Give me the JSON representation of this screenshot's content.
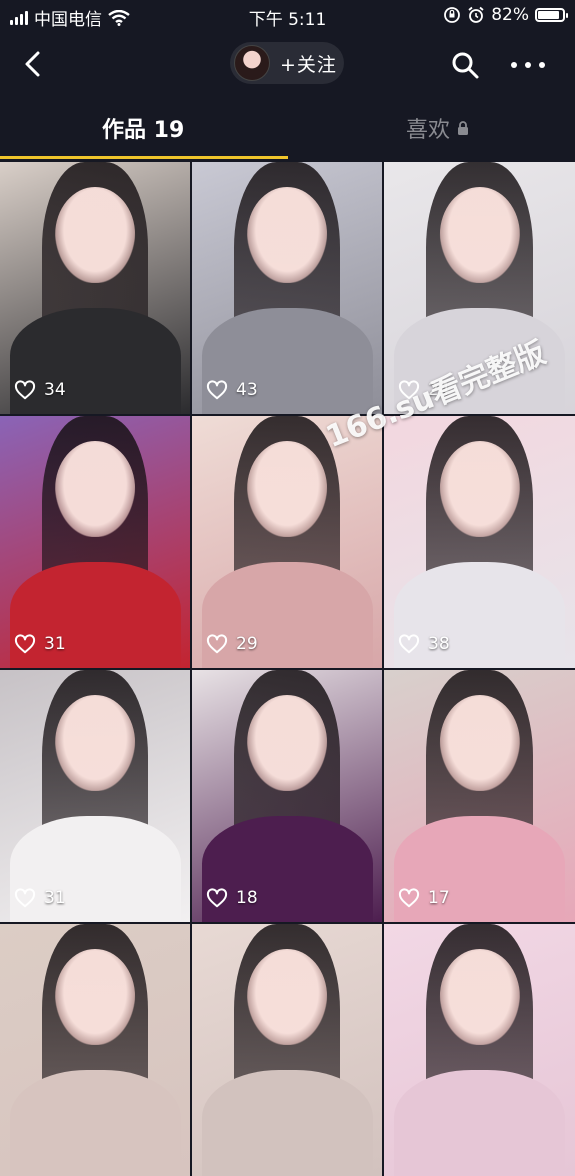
{
  "status": {
    "carrier": "中国电信",
    "time": "下午 5:11",
    "battery": "82%"
  },
  "nav": {
    "follow_label": "+关注"
  },
  "tabs": {
    "works": "作品 19",
    "likes": "喜欢"
  },
  "watermark": "166.su看完整版",
  "videos": [
    {
      "likes": "34",
      "colors": [
        "#d9cfc8",
        "#2b2b2e"
      ]
    },
    {
      "likes": "43",
      "colors": [
        "#c9c9d4",
        "#8e8e98"
      ]
    },
    {
      "likes": "24",
      "colors": [
        "#e9e7ea",
        "#d7d4da"
      ]
    },
    {
      "likes": "31",
      "colors": [
        "#8a64b7",
        "#c32430"
      ]
    },
    {
      "likes": "29",
      "colors": [
        "#efdcd6",
        "#d7a6a8"
      ]
    },
    {
      "likes": "38",
      "colors": [
        "#f3d7df",
        "#e7e4ea"
      ]
    },
    {
      "likes": "31",
      "colors": [
        "#c7c2c6",
        "#f2f0f1"
      ]
    },
    {
      "likes": "18",
      "colors": [
        "#e8e2e5",
        "#4d1e4f"
      ]
    },
    {
      "likes": "17",
      "colors": [
        "#d8d0cc",
        "#e7a7b8"
      ]
    },
    {
      "likes": "",
      "colors": [
        "#dccdc5",
        "#d7c4bf"
      ]
    },
    {
      "likes": "",
      "colors": [
        "#e8d9d4",
        "#d2c2be"
      ]
    },
    {
      "likes": "",
      "colors": [
        "#f2d8e5",
        "#e6c6d6"
      ]
    }
  ]
}
